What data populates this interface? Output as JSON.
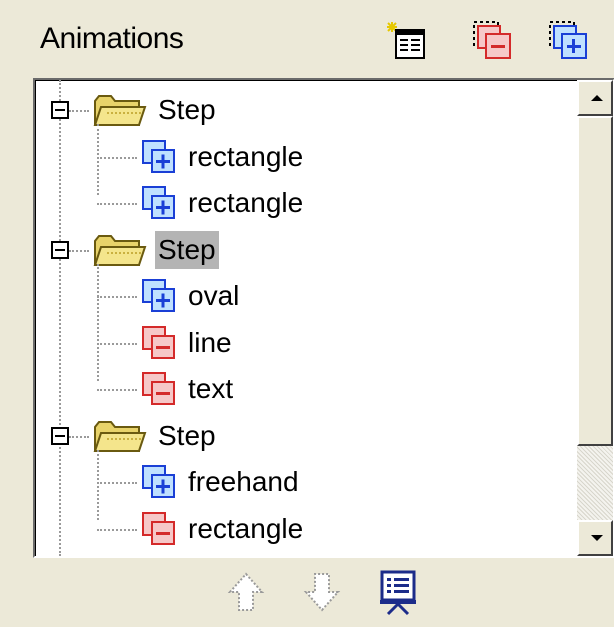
{
  "panel": {
    "title": "Animations",
    "toolbar": [
      {
        "name": "new-step-button",
        "icon": "new-step-icon"
      },
      {
        "name": "remove-effect-button",
        "icon": "remove-effect-icon"
      },
      {
        "name": "add-effect-button",
        "icon": "add-effect-icon"
      }
    ]
  },
  "tree": {
    "steps": [
      {
        "label": "Step",
        "selected": false,
        "expanded": true,
        "items": [
          {
            "label": "rectangle",
            "kind": "add"
          },
          {
            "label": "rectangle",
            "kind": "add"
          }
        ]
      },
      {
        "label": "Step",
        "selected": true,
        "expanded": true,
        "items": [
          {
            "label": "oval",
            "kind": "add"
          },
          {
            "label": "line",
            "kind": "remove"
          },
          {
            "label": "text",
            "kind": "remove"
          }
        ]
      },
      {
        "label": "Step",
        "selected": false,
        "expanded": true,
        "items": [
          {
            "label": "freehand",
            "kind": "add"
          },
          {
            "label": "rectangle",
            "kind": "remove"
          }
        ]
      }
    ]
  },
  "footer": {
    "buttons": [
      {
        "name": "move-up-button",
        "icon": "move-up-arrow-icon",
        "enabled": false
      },
      {
        "name": "move-down-button",
        "icon": "move-down-arrow-icon",
        "enabled": false
      },
      {
        "name": "presentation-button",
        "icon": "presentation-icon",
        "enabled": true
      }
    ]
  },
  "colors": {
    "add": "#1a3fd6",
    "remove": "#d42a2a",
    "folder": "#e8d36a",
    "selection": "#b4b4b4",
    "panel_bg": "#ece9d8"
  }
}
